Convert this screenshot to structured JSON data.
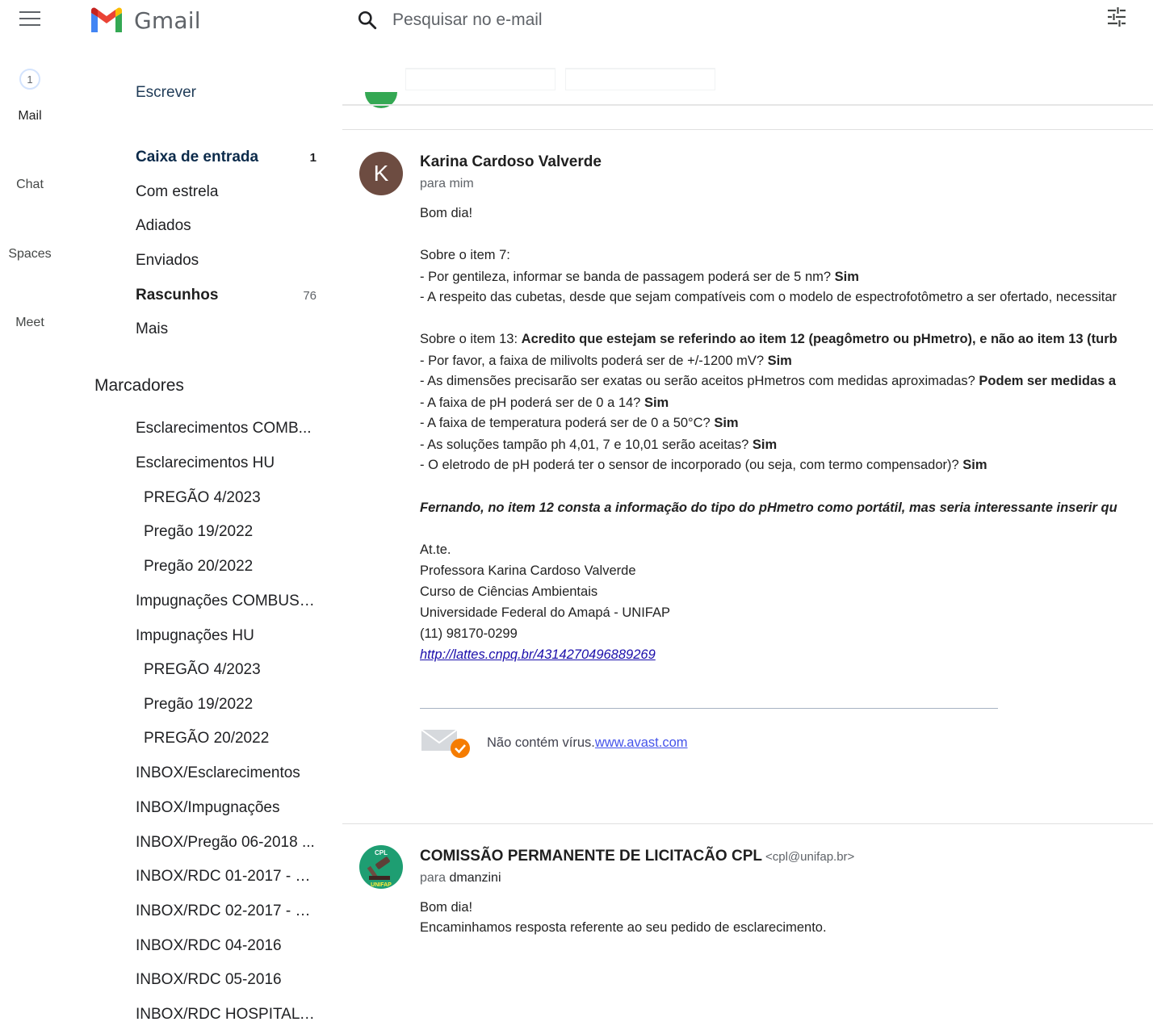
{
  "app": {
    "name": "Gmail",
    "search_placeholder": "Pesquisar no e-mail"
  },
  "rail": {
    "badge": "1",
    "items": [
      {
        "label": "Mail"
      },
      {
        "label": "Chat"
      },
      {
        "label": "Spaces"
      },
      {
        "label": "Meet"
      }
    ]
  },
  "nav": {
    "compose": "Escrever",
    "items": [
      {
        "label": "Caixa de entrada",
        "count": "1"
      },
      {
        "label": "Com estrela",
        "count": ""
      },
      {
        "label": "Adiados",
        "count": ""
      },
      {
        "label": "Enviados",
        "count": ""
      },
      {
        "label": "Rascunhos",
        "count": "76"
      },
      {
        "label": "Mais",
        "count": ""
      }
    ],
    "labels_heading": "Marcadores",
    "labels": [
      "Esclarecimentos COMB...",
      "Esclarecimentos HU",
      "PREGÃO 4/2023",
      "Pregão 19/2022",
      "Pregão 20/2022",
      "Impugnações COMBUST...",
      "Impugnações HU",
      "PREGÃO 4/2023",
      "Pregão 19/2022",
      "PREGÃO 20/2022",
      "INBOX/Esclarecimentos",
      "INBOX/Impugnações",
      "INBOX/Pregão 06-2018 ...",
      "INBOX/RDC 01-2017 - Bi...",
      "INBOX/RDC 02-2017 - U...",
      "INBOX/RDC 04-2016",
      "INBOX/RDC 05-2016",
      "INBOX/RDC HOSPITAL U..."
    ]
  },
  "message1": {
    "avatar_letter": "K",
    "sender": "Karina Cardoso Valverde",
    "to_prefix": "para ",
    "to": "mim",
    "greeting": "Bom dia!",
    "item7_heading": "Sobre o item 7:",
    "q1": "- Por gentileza, informar se banda de passagem poderá ser de 5 nm? ",
    "a1": "Sim",
    "q2": "- A respeito das cubetas, desde que sejam compatíveis com o modelo de espectrofotômetro a ser ofertado, necessitar",
    "item13_prefix": "Sobre o item 13: ",
    "item13_bold": "Acredito que estejam se referindo ao item 12 (peagômetro ou pHmetro), e não ao item 13 (turb",
    "q3": "- Por favor, a faixa de milivolts poderá ser de +/-1200 mV? ",
    "a3": "Sim",
    "q4": "- As dimensões precisarão ser exatas ou serão aceitos pHmetros com medidas aproximadas? ",
    "a4": "Podem ser medidas a",
    "q5": "- A faixa de pH poderá ser de 0 a 14? ",
    "a5": "Sim",
    "q6": "- A faixa de temperatura poderá ser de 0 a 50°C? ",
    "a6": "Sim",
    "q7": "- As soluções tampão ph 4,01, 7 e 10,01 serão aceitas? ",
    "a7": "Sim",
    "q8": "- O eletrodo de pH poderá ter o sensor de incorporado (ou seja, com termo compensador)? ",
    "a8": "Sim",
    "note": "Fernando, no item 12 consta a informação do tipo do pHmetro como portátil, mas seria interessante inserir qu",
    "sig_att": "At.te.",
    "sig_name": "Professora Karina Cardoso Valverde",
    "sig_course": "Curso de Ciências Ambientais",
    "sig_univ": "Universidade Federal do Amapá - UNIFAP",
    "sig_phone": "(11) 98170-0299",
    "sig_link": "http://lattes.cnpq.br/4314270496889269",
    "avast_text": "Não contém vírus.",
    "avast_link": "www.avast.com"
  },
  "message2": {
    "avatar_text_top": "CPL",
    "avatar_text_bottom": "UNIFAP",
    "sender": "COMISSÃO PERMANENTE DE LICITACÃO CPL",
    "sender_email": "<cpl@unifap.br>",
    "to_prefix": "para ",
    "to": "dmanzini",
    "line1": "Bom dia!",
    "line2": "Encaminhamos resposta referente ao seu pedido de esclarecimento."
  },
  "colors": {
    "avatar_k": "#6d4c41",
    "avatar_cpl": "#1e9e72",
    "link": "#1a0dab",
    "avast_check": "#f57c00"
  }
}
